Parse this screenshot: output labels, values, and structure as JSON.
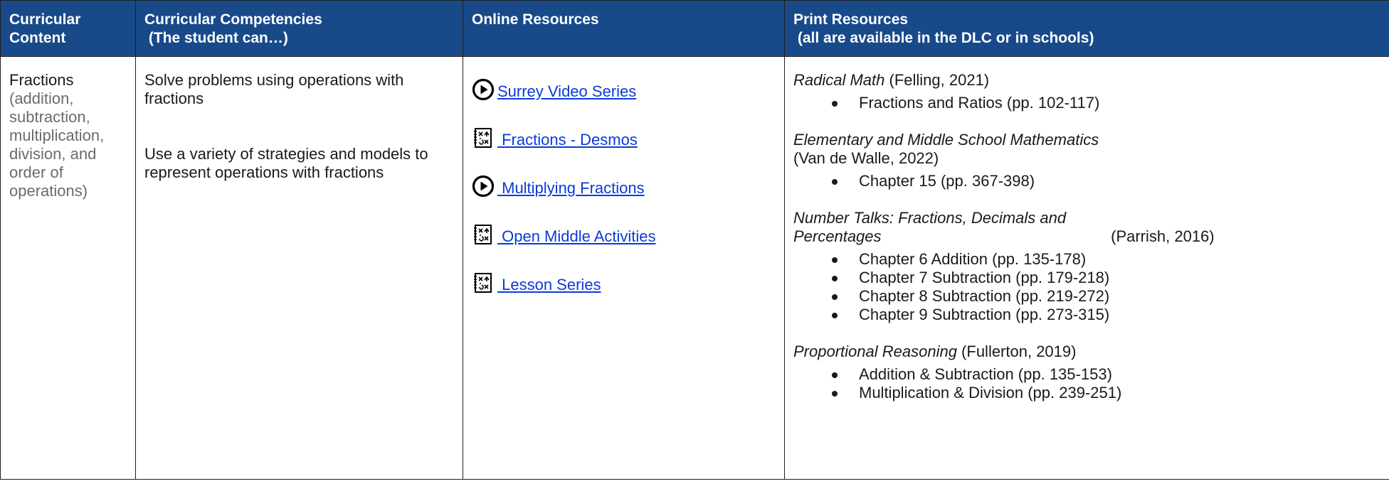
{
  "headers": [
    {
      "lines": [
        "Curricular",
        "Content"
      ]
    },
    {
      "lines": [
        "Curricular Competencies",
        " (The student can…)"
      ]
    },
    {
      "lines": [
        "Online Resources"
      ]
    },
    {
      "lines": [
        "Print Resources",
        " (all are available in the DLC or in schools)"
      ]
    }
  ],
  "content": {
    "main": "Fractions",
    "detail": "(addition, subtraction, multiplication, division, and order of operations)"
  },
  "competencies": [
    "Solve problems using operations with fractions",
    "Use a variety of strategies and models to represent operations with fractions"
  ],
  "online_resources": [
    {
      "icon": "play-circle-icon",
      "label": "Surrey Video Series"
    },
    {
      "icon": "math-activity-icon",
      "label": " Fractions - Desmos"
    },
    {
      "icon": "play-circle-icon",
      "label": " Multiplying Fractions"
    },
    {
      "icon": "math-activity-icon",
      "label": " Open Middle Activities"
    },
    {
      "icon": "math-activity-icon",
      "label": " Lesson Series"
    }
  ],
  "print_resources": [
    {
      "title": "Radical Math",
      "cite": " (Felling, 2021)",
      "chapters": [
        "Fractions and Ratios (pp. 102-117)"
      ]
    },
    {
      "title": "Elementary and Middle School Mathematics",
      "cite": "(Van de Walle, 2022)",
      "chapters": [
        "Chapter 15 (pp. 367-398)"
      ]
    },
    {
      "title": "Number Talks: Fractions, Decimals and Percentages",
      "cite": " (Parrish, 2016)",
      "chapters": [
        "Chapter 6 Addition (pp. 135-178)",
        "Chapter 7 Subtraction (pp. 179-218)",
        "Chapter 8 Subtraction (pp. 219-272)",
        "Chapter 9 Subtraction (pp. 273-315)"
      ]
    },
    {
      "title": "Proportional Reasoning",
      "cite": " (Fullerton, 2019)",
      "chapters": [
        "Addition & Subtraction (pp. 135-153)",
        "Multiplication & Division (pp. 239-251)"
      ]
    }
  ],
  "colors": {
    "header_bg": "#184a8a",
    "link": "#0b3bd6",
    "muted": "#6b6b6b"
  }
}
